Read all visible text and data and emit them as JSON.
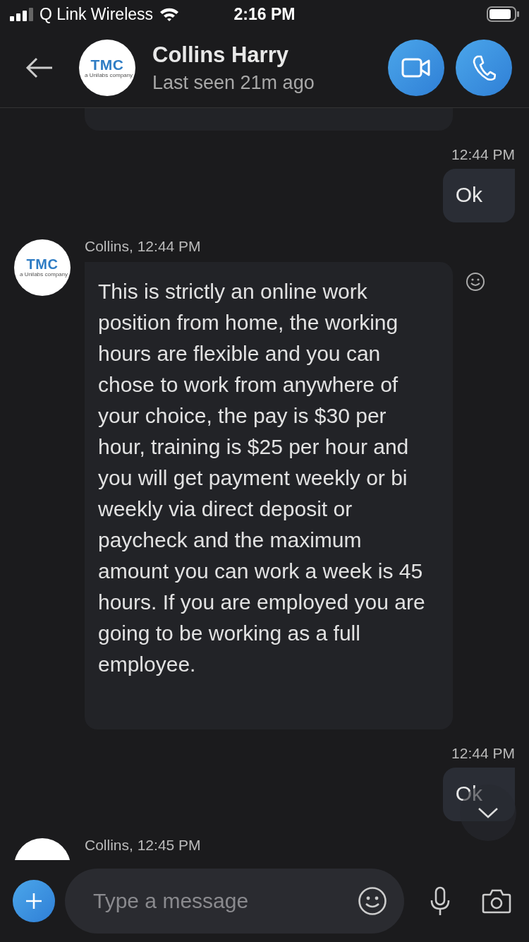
{
  "status_bar": {
    "carrier": "Q Link Wireless",
    "time": "2:16 PM"
  },
  "header": {
    "avatar_logo": "TMC",
    "avatar_tagline": "a Unilabs company",
    "name": "Collins Harry",
    "subtitle": "Last seen 21m ago"
  },
  "messages": [
    {
      "kind": "sent",
      "time": "12:44 PM",
      "text": "Ok"
    },
    {
      "kind": "received",
      "sender_time": "Collins, 12:44 PM",
      "avatar_logo": "TMC",
      "avatar_tagline": "a Unilabs company",
      "text": "This is strictly an online work position from home, the working hours are flexible and you can chose to work from anywhere of your choice, the pay is $30 per hour, training is $25 per hour and you will get payment weekly or bi weekly via direct deposit or paycheck and the maximum amount you can work a week is 45 hours. If you are employed you are going to be working as a full employee."
    },
    {
      "kind": "sent",
      "time": "12:44 PM",
      "text": "Ok"
    },
    {
      "kind": "received",
      "sender_time": "Collins, 12:45 PM"
    }
  ],
  "composer": {
    "placeholder": "Type a message"
  }
}
